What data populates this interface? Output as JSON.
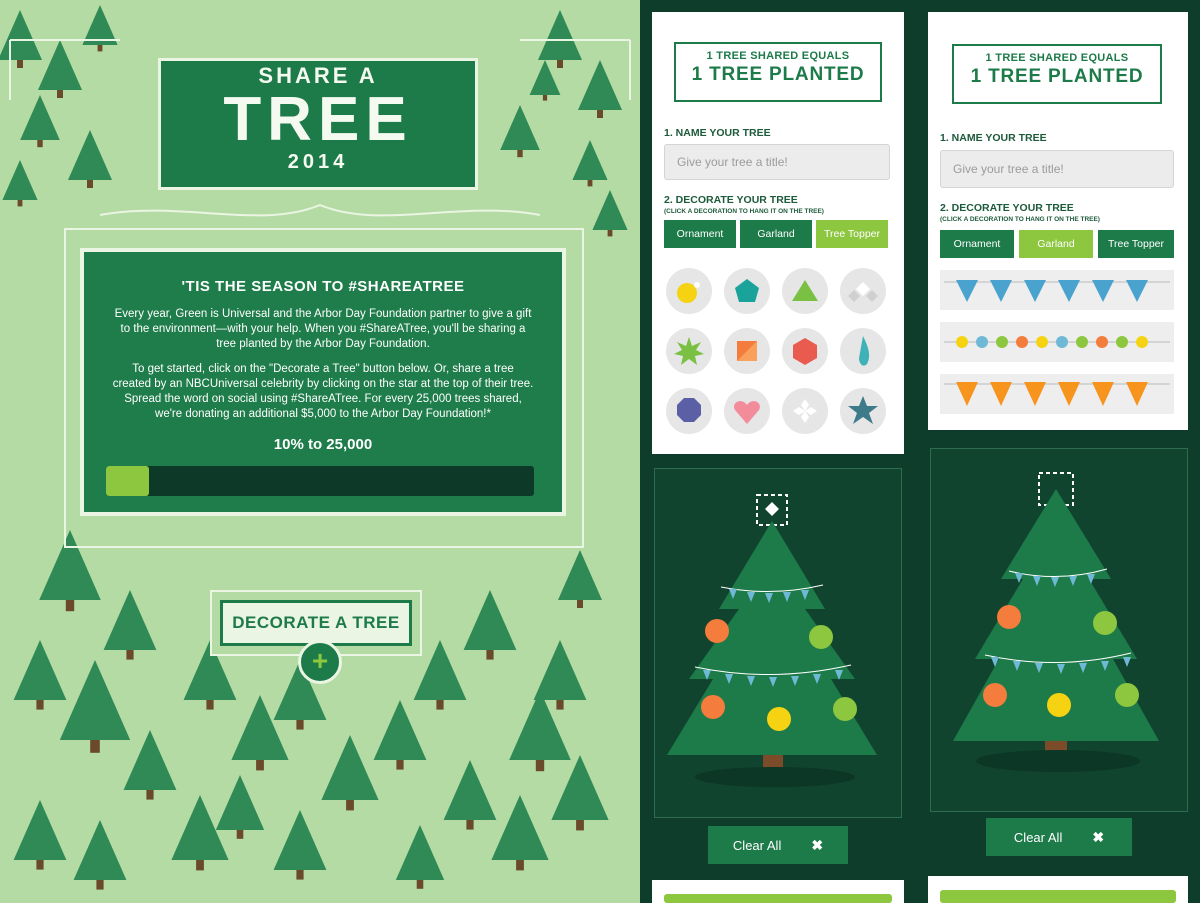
{
  "left": {
    "logo": {
      "line1": "SHARE A",
      "line2": "TREE",
      "line3": "2014"
    },
    "card": {
      "heading": "'TIS THE SEASON TO #SHAREATREE",
      "para1": "Every year, Green is Universal and the Arbor Day Foundation partner to give a gift to the environment—with your help. When you #ShareATree, you'll be sharing a tree planted by the Arbor Day Foundation.",
      "para2": "To get started, click on the \"Decorate a Tree\" button below. Or, share a tree created by an NBCUniversal celebrity by clicking on the star at the top of their tree. Spread the word on social using #ShareATree. For every 25,000 trees shared, we're donating an additional $5,000 to the Arbor Day Foundation!*",
      "progress_label": "10% to 25,000",
      "progress_fraction": 0.1
    },
    "decorate_button": "DECORATE A TREE",
    "plus_symbol": "+"
  },
  "editor_ornament": {
    "header_line1": "1 TREE SHARED EQUALS",
    "header_line2": "1 TREE PLANTED",
    "name_label": "1. NAME YOUR TREE",
    "title_placeholder": "Give your tree a title!",
    "decorate_label": "2. DECORATE YOUR TREE",
    "decorate_hint": "(CLICK A DECORATION TO HANG IT ON THE TREE)",
    "tabs": [
      "Ornament",
      "Garland",
      "Tree Topper"
    ],
    "active_tab": "Tree Topper",
    "clear_label": "Clear All",
    "clear_icon": "✖"
  },
  "editor_garland": {
    "header_line1": "1 TREE SHARED EQUALS",
    "header_line2": "1 TREE PLANTED",
    "name_label": "1. NAME YOUR TREE",
    "title_placeholder": "Give your tree a title!",
    "decorate_label": "2. DECORATE YOUR TREE",
    "decorate_hint": "(CLICK A DECORATION TO HANG IT ON THE TREE)",
    "tabs": [
      "Ornament",
      "Garland",
      "Tree Topper"
    ],
    "active_tab": "Garland",
    "clear_label": "Clear All",
    "clear_icon": "✖"
  },
  "colors": {
    "dark_green": "#0f3d2c",
    "brand_green": "#1d7a49",
    "light_green": "#8dc63f",
    "mint_bg": "#b5dba4"
  }
}
